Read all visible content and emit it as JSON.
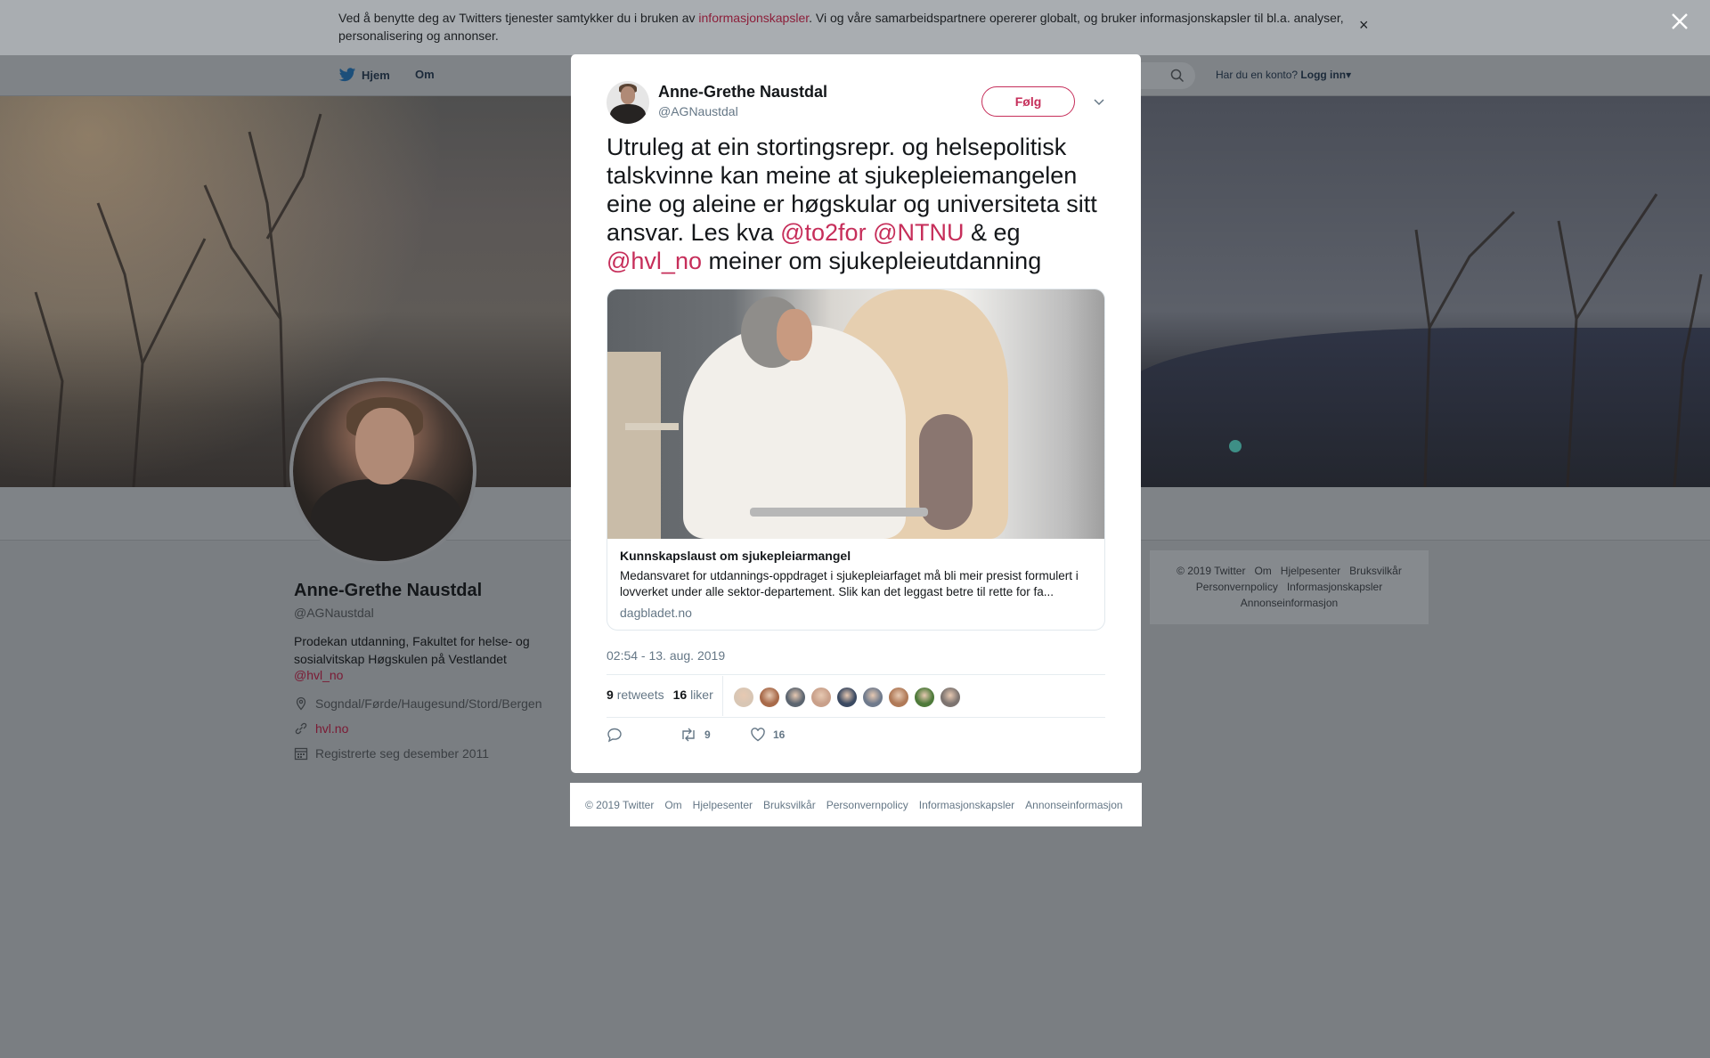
{
  "cookie_banner": {
    "text_before": "Ved å benytte deg av Twitters tjenester samtykker du i bruken av ",
    "link": "informasjonskapsler",
    "text_after": ". Vi og våre samarbeidspartnere opererer globalt, og bruker informasjonskapsler til bl.a. analyser, personalisering og annonser.",
    "close": "×"
  },
  "nav": {
    "home": "Hjem",
    "about": "Om",
    "login_prompt": "Har du en konto?",
    "login": "Logg inn",
    "login_caret": "▾"
  },
  "profile": {
    "name": "Anne-Grethe Naustdal",
    "handle": "@AGNaustdal",
    "bio": "Prodekan utdanning, Fakultet for helse- og sosialvitskap Høgskulen på Vestlandet",
    "bio_link": "@hvl_no",
    "location": "Sogndal/Førde/Haugesund/Stord/Bergen",
    "url": "hvl.no",
    "joined": "Registrerte seg desember 2011"
  },
  "side_footer": {
    "items": [
      "© 2019 Twitter",
      "Om",
      "Hjelpesenter",
      "Bruksvilkår",
      "Personvernpolicy",
      "Informasjonskapsler",
      "Annonseinformasjon"
    ]
  },
  "tweet": {
    "author_name": "Anne-Grethe Naustdal",
    "author_handle": "@AGNaustdal",
    "follow_label": "Følg",
    "text_part1": "Utruleg at ein stortingsrepr. og helsepolitisk talskvinne kan meine at sjukepleiemangelen eine og aleine er høgskular og universiteta sitt ansvar. Les kva ",
    "mention1": "@to2for",
    "text_part2": " ",
    "mention2": "@NTNU",
    "text_part3": " & eg ",
    "mention3": "@hvl_no",
    "text_part4": " meiner om sjukepleieutdanning",
    "card": {
      "title": "Kunnskapslaust om sjukepleiarmangel",
      "description": "Medansvaret for utdannings-oppdraget i sjukepleiarfaget må bli meir presist formulert i lovverket under alle sektor-departement. Slik kan det leggast betre til rette for fa...",
      "domain": "dagbladet.no"
    },
    "timestamp": "02:54 - 13. aug. 2019",
    "retweets_count": "9",
    "retweets_label": "retweets",
    "likes_count": "16",
    "likes_label": "liker",
    "action_retweets": "9",
    "action_likes": "16",
    "liker_colors": [
      "#d8c6b4",
      "#a86a4a",
      "#5c6570",
      "#c9a08a",
      "#3b4a62",
      "#6f7a8c",
      "#b07a58",
      "#4e7a3a",
      "#7d7470"
    ]
  },
  "modal_footer": {
    "items": [
      "© 2019 Twitter",
      "Om",
      "Hjelpesenter",
      "Bruksvilkår",
      "Personvernpolicy",
      "Informasjonskapsler",
      "Annonseinformasjon"
    ]
  },
  "colors": {
    "accent": "#c62e5a",
    "overlay": "#7a7e82"
  }
}
